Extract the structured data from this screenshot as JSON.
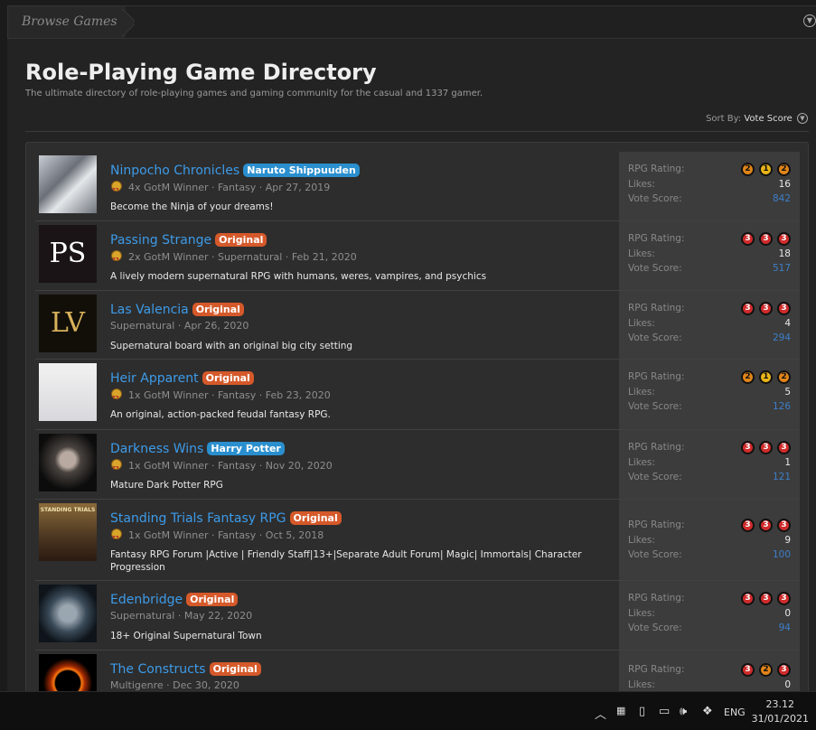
{
  "breadcrumb": {
    "label": "Browse Games"
  },
  "page": {
    "title": "Role-Playing Game Directory",
    "description": "The ultimate directory of role-playing games and gaming community for the casual and 1337 gamer."
  },
  "sort": {
    "label": "Sort By:",
    "value": "Vote Score"
  },
  "stat_labels": {
    "rating": "RPG Rating:",
    "likes": "Likes:",
    "vote": "Vote Score:"
  },
  "games": [
    {
      "name": "Ninpocho Chronicles",
      "badge": "Naruto Shippuuden",
      "badge_type": "canon",
      "meta": "4x GotM Winner · Fantasy · Apr 27, 2019",
      "award": true,
      "desc": "Become the Ninja of your dreams!",
      "rating": [
        "2",
        "1",
        "2"
      ],
      "likes": "16",
      "vote": "842"
    },
    {
      "name": "Passing Strange",
      "badge": "Original",
      "badge_type": "orig",
      "meta": "2x GotM Winner · Supernatural · Feb 21, 2020",
      "award": true,
      "desc": "A lively modern supernatural RPG with humans, weres, vampires, and psychics",
      "rating": [
        "3",
        "3",
        "3"
      ],
      "likes": "18",
      "vote": "517",
      "thumb_text": "PS"
    },
    {
      "name": "Las Valencia",
      "badge": "Original",
      "badge_type": "orig",
      "meta": "Supernatural · Apr 26, 2020",
      "award": false,
      "desc": "Supernatural board with an original big city setting",
      "rating": [
        "3",
        "3",
        "3"
      ],
      "likes": "4",
      "vote": "294",
      "thumb_text": "LV"
    },
    {
      "name": "Heir Apparent",
      "badge": "Original",
      "badge_type": "orig",
      "meta": "1x GotM Winner · Fantasy · Feb 23, 2020",
      "award": true,
      "desc": "An original, action-packed feudal fantasy RPG.",
      "rating": [
        "2",
        "1",
        "2"
      ],
      "likes": "5",
      "vote": "126"
    },
    {
      "name": "Darkness Wins",
      "badge": "Harry Potter",
      "badge_type": "canon",
      "meta": "1x GotM Winner · Fantasy · Nov 20, 2020",
      "award": true,
      "desc": "Mature Dark Potter RPG",
      "rating": [
        "3",
        "3",
        "3"
      ],
      "likes": "1",
      "vote": "121"
    },
    {
      "name": "Standing Trials Fantasy RPG",
      "badge": "Original",
      "badge_type": "orig",
      "meta": "1x GotM Winner · Fantasy · Oct 5, 2018",
      "award": true,
      "desc": "Fantasy RPG Forum |Active | Friendly Staff|13+|Separate Adult Forum| Magic| Immortals| Character Progression",
      "rating": [
        "3",
        "3",
        "3"
      ],
      "likes": "9",
      "vote": "100",
      "thumb_text": "STANDING TRIALS"
    },
    {
      "name": "Edenbridge",
      "badge": "Original",
      "badge_type": "orig",
      "meta": "Supernatural · May 22, 2020",
      "award": false,
      "desc": "18+ Original Supernatural Town",
      "rating": [
        "3",
        "3",
        "3"
      ],
      "likes": "0",
      "vote": "94"
    },
    {
      "name": "The Constructs",
      "badge": "Original",
      "badge_type": "orig",
      "meta": "Multigenre · Dec 30, 2020",
      "award": false,
      "desc": "",
      "rating": [
        "3",
        "2",
        "3"
      ],
      "likes": "0",
      "vote": ""
    }
  ],
  "taskbar": {
    "lang": "ENG",
    "time": "23.12",
    "date": "31/01/2021"
  }
}
